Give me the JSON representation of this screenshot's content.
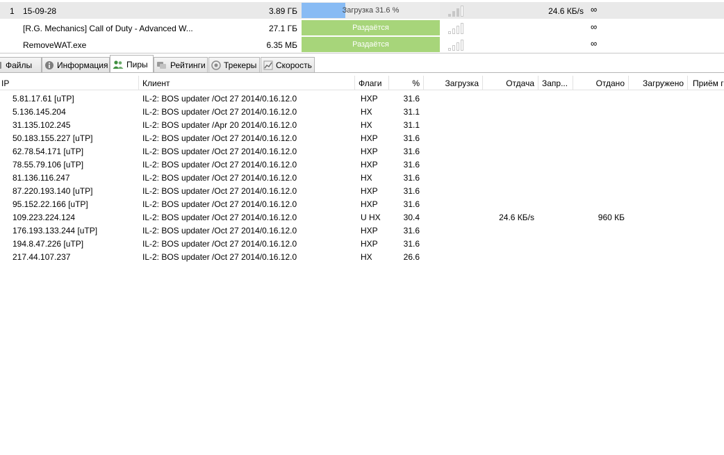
{
  "torrents": [
    {
      "num": "1",
      "name": "15-09-28",
      "size": "3.89 ГБ",
      "status": "Загрузка 31.6 %",
      "progress": 0.316,
      "state": "downloading",
      "health_bars": 4,
      "health_on": 3,
      "speed": "24.6 КБ/s",
      "ratio": "∞"
    },
    {
      "num": "",
      "name": "[R.G. Mechanics] Call of Duty - Advanced W...",
      "size": "27.1 ГБ",
      "status": "Раздаётся",
      "progress": 1.0,
      "state": "seeding",
      "health_bars": 4,
      "health_on": 0,
      "speed": "",
      "ratio": "∞"
    },
    {
      "num": "",
      "name": "RemoveWAT.exe",
      "size": "6.35 МБ",
      "status": "Раздаётся",
      "progress": 1.0,
      "state": "seeding",
      "health_bars": 4,
      "health_on": 0,
      "speed": "",
      "ratio": "∞"
    }
  ],
  "tabs": [
    {
      "key": "files",
      "label": "Файлы",
      "icon": "files-icon",
      "active": false
    },
    {
      "key": "info",
      "label": "Информация",
      "icon": "info-icon",
      "active": false
    },
    {
      "key": "peers",
      "label": "Пиры",
      "icon": "peers-icon",
      "active": true
    },
    {
      "key": "ratings",
      "label": "Рейтинги",
      "icon": "ratings-icon",
      "active": false
    },
    {
      "key": "trackers",
      "label": "Трекеры",
      "icon": "trackers-icon",
      "active": false
    },
    {
      "key": "speed",
      "label": "Скорость",
      "icon": "speed-icon",
      "active": false
    }
  ],
  "peers": {
    "columns": {
      "ip": "IP",
      "client": "Клиент",
      "flags": "Флаги",
      "percent": "%",
      "down": "Загрузка",
      "up": "Отдача",
      "reqs": "Запр...",
      "uploaded": "Отдано",
      "downloaded": "Загружено",
      "recv": "Приём г"
    },
    "rows": [
      {
        "ip": "5.81.17.61 [uTP]",
        "client": "IL-2: BOS updater /Oct 27 2014/0.16.12.0",
        "flags": "HXP",
        "percent": "31.6",
        "down": "",
        "up": "",
        "uploaded": "",
        "downloaded": ""
      },
      {
        "ip": "5.136.145.204",
        "client": "IL-2: BOS updater /Oct 27 2014/0.16.12.0",
        "flags": "HX",
        "percent": "31.1",
        "down": "",
        "up": "",
        "uploaded": "",
        "downloaded": ""
      },
      {
        "ip": "31.135.102.245",
        "client": "IL-2: BOS updater /Apr 20 2014/0.16.12.0",
        "flags": "HX",
        "percent": "31.1",
        "down": "",
        "up": "",
        "uploaded": "",
        "downloaded": ""
      },
      {
        "ip": "50.183.155.227 [uTP]",
        "client": "IL-2: BOS updater /Oct 27 2014/0.16.12.0",
        "flags": "HXP",
        "percent": "31.6",
        "down": "",
        "up": "",
        "uploaded": "",
        "downloaded": ""
      },
      {
        "ip": "62.78.54.171 [uTP]",
        "client": "IL-2: BOS updater /Oct 27 2014/0.16.12.0",
        "flags": "HXP",
        "percent": "31.6",
        "down": "",
        "up": "",
        "uploaded": "",
        "downloaded": ""
      },
      {
        "ip": "78.55.79.106 [uTP]",
        "client": "IL-2: BOS updater /Oct 27 2014/0.16.12.0",
        "flags": "HXP",
        "percent": "31.6",
        "down": "",
        "up": "",
        "uploaded": "",
        "downloaded": ""
      },
      {
        "ip": "81.136.116.247",
        "client": "IL-2: BOS updater /Oct 27 2014/0.16.12.0",
        "flags": "HX",
        "percent": "31.6",
        "down": "",
        "up": "",
        "uploaded": "",
        "downloaded": ""
      },
      {
        "ip": "87.220.193.140 [uTP]",
        "client": "IL-2: BOS updater /Oct 27 2014/0.16.12.0",
        "flags": "HXP",
        "percent": "31.6",
        "down": "",
        "up": "",
        "uploaded": "",
        "downloaded": ""
      },
      {
        "ip": "95.152.22.166 [uTP]",
        "client": "IL-2: BOS updater /Oct 27 2014/0.16.12.0",
        "flags": "HXP",
        "percent": "31.6",
        "down": "",
        "up": "",
        "uploaded": "",
        "downloaded": ""
      },
      {
        "ip": "109.223.224.124",
        "client": "IL-2: BOS updater /Oct 27 2014/0.16.12.0",
        "flags": "U HX",
        "percent": "30.4",
        "down": "24.6 КБ/s",
        "up": "",
        "uploaded": "960 КБ",
        "downloaded": ""
      },
      {
        "ip": "176.193.133.244 [uTP]",
        "client": "IL-2: BOS updater /Oct 27 2014/0.16.12.0",
        "flags": "HXP",
        "percent": "31.6",
        "down": "",
        "up": "",
        "uploaded": "",
        "downloaded": ""
      },
      {
        "ip": "194.8.47.226 [uTP]",
        "client": "IL-2: BOS updater /Oct 27 2014/0.16.12.0",
        "flags": "HXP",
        "percent": "31.6",
        "down": "",
        "up": "",
        "uploaded": "",
        "downloaded": ""
      },
      {
        "ip": "217.44.107.237",
        "client": "IL-2: BOS updater /Oct 27 2014/0.16.12.0",
        "flags": "HX",
        "percent": "26.6",
        "down": "",
        "up": "",
        "uploaded": "",
        "downloaded": ""
      }
    ]
  },
  "colors": {
    "download_fill": "#88bbf4",
    "seed_fill": "#a7d57a",
    "row_selected": "#e9e9e9"
  }
}
